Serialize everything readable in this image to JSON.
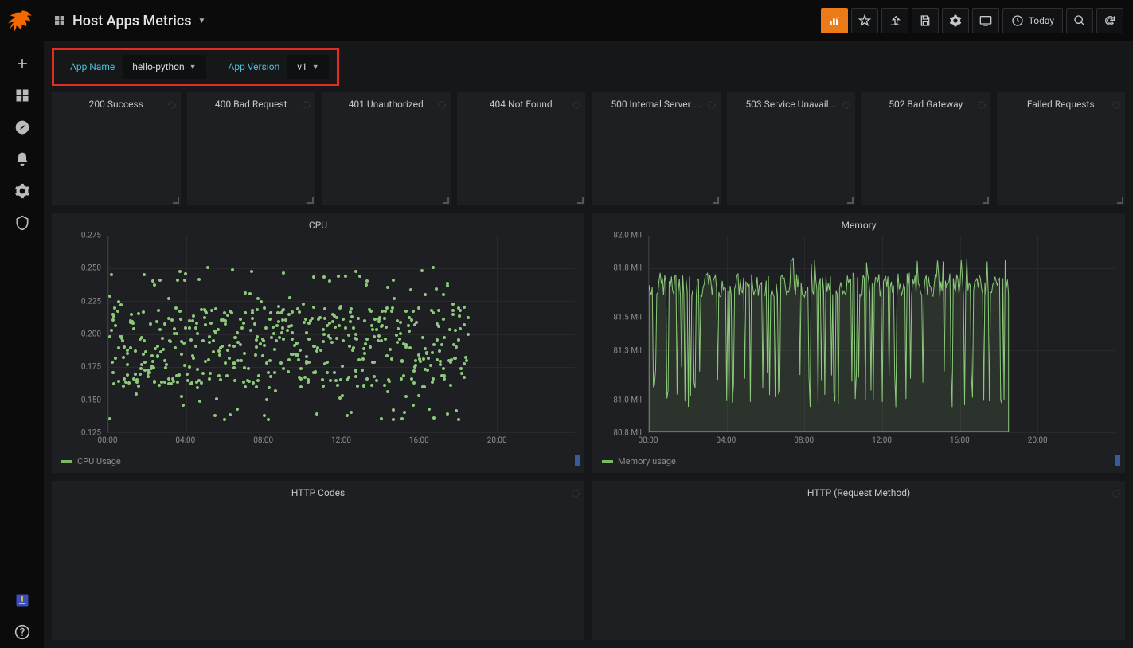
{
  "header": {
    "dashboard_title": "Host Apps Metrics",
    "time_range": "Today"
  },
  "variables": {
    "app_name_label": "App Name",
    "app_name_value": "hello-python",
    "app_version_label": "App Version",
    "app_version_value": "v1"
  },
  "stat_panels": [
    {
      "title": "200 Success"
    },
    {
      "title": "400 Bad Request"
    },
    {
      "title": "401 Unauthorized"
    },
    {
      "title": "404 Not Found"
    },
    {
      "title": "500 Internal Server ..."
    },
    {
      "title": "503 Service Unavail..."
    },
    {
      "title": "502 Bad Gateway"
    },
    {
      "title": "Failed Requests"
    }
  ],
  "cpu_panel": {
    "title": "CPU",
    "legend": "CPU Usage"
  },
  "memory_panel": {
    "title": "Memory",
    "legend": "Memory usage"
  },
  "http_codes_panel": {
    "title": "HTTP Codes"
  },
  "http_method_panel": {
    "title": "HTTP (Request Method)"
  },
  "chart_data": [
    {
      "id": "cpu",
      "type": "scatter",
      "title": "CPU",
      "xlabel": "",
      "ylabel": "",
      "ylim": [
        0.125,
        0.275
      ],
      "yticks": [
        0.125,
        0.15,
        0.175,
        0.2,
        0.225,
        0.25,
        0.275
      ],
      "xticks": [
        "00:00",
        "04:00",
        "08:00",
        "12:00",
        "16:00",
        "20:00"
      ],
      "x_range_hours": [
        0,
        24
      ],
      "data_range_hours": [
        0,
        18.5
      ],
      "series": [
        {
          "name": "CPU Usage",
          "color": "#8cc97a",
          "values_note": "Scatter cluster approx. centered 0.19, spanning ~0.135 to 0.258, from 00:00 to ~18:30",
          "approx_center": 0.19,
          "approx_min": 0.135,
          "approx_max": 0.258,
          "point_count_estimate": 560
        }
      ]
    },
    {
      "id": "memory",
      "type": "area",
      "title": "Memory",
      "xlabel": "",
      "ylabel": "",
      "ylim_units": "Mil",
      "ylim": [
        80.8,
        82.0
      ],
      "yticks": [
        80.8,
        81.0,
        81.3,
        81.5,
        81.8,
        82.0
      ],
      "ytick_labels": [
        "80.8 Mil",
        "81.0 Mil",
        "81.3 Mil",
        "81.5 Mil",
        "81.8 Mil",
        "82.0 Mil"
      ],
      "xticks": [
        "00:00",
        "04:00",
        "08:00",
        "12:00",
        "16:00",
        "20:00"
      ],
      "x_range_hours": [
        0,
        24
      ],
      "data_range_hours": [
        0,
        18.5
      ],
      "series": [
        {
          "name": "Memory usage",
          "color": "#8cc97a",
          "values_note": "Highly spiky line oscillating roughly between 80.9M and 81.85M, mostly near 81.7M with frequent sharp dips"
        }
      ]
    }
  ]
}
